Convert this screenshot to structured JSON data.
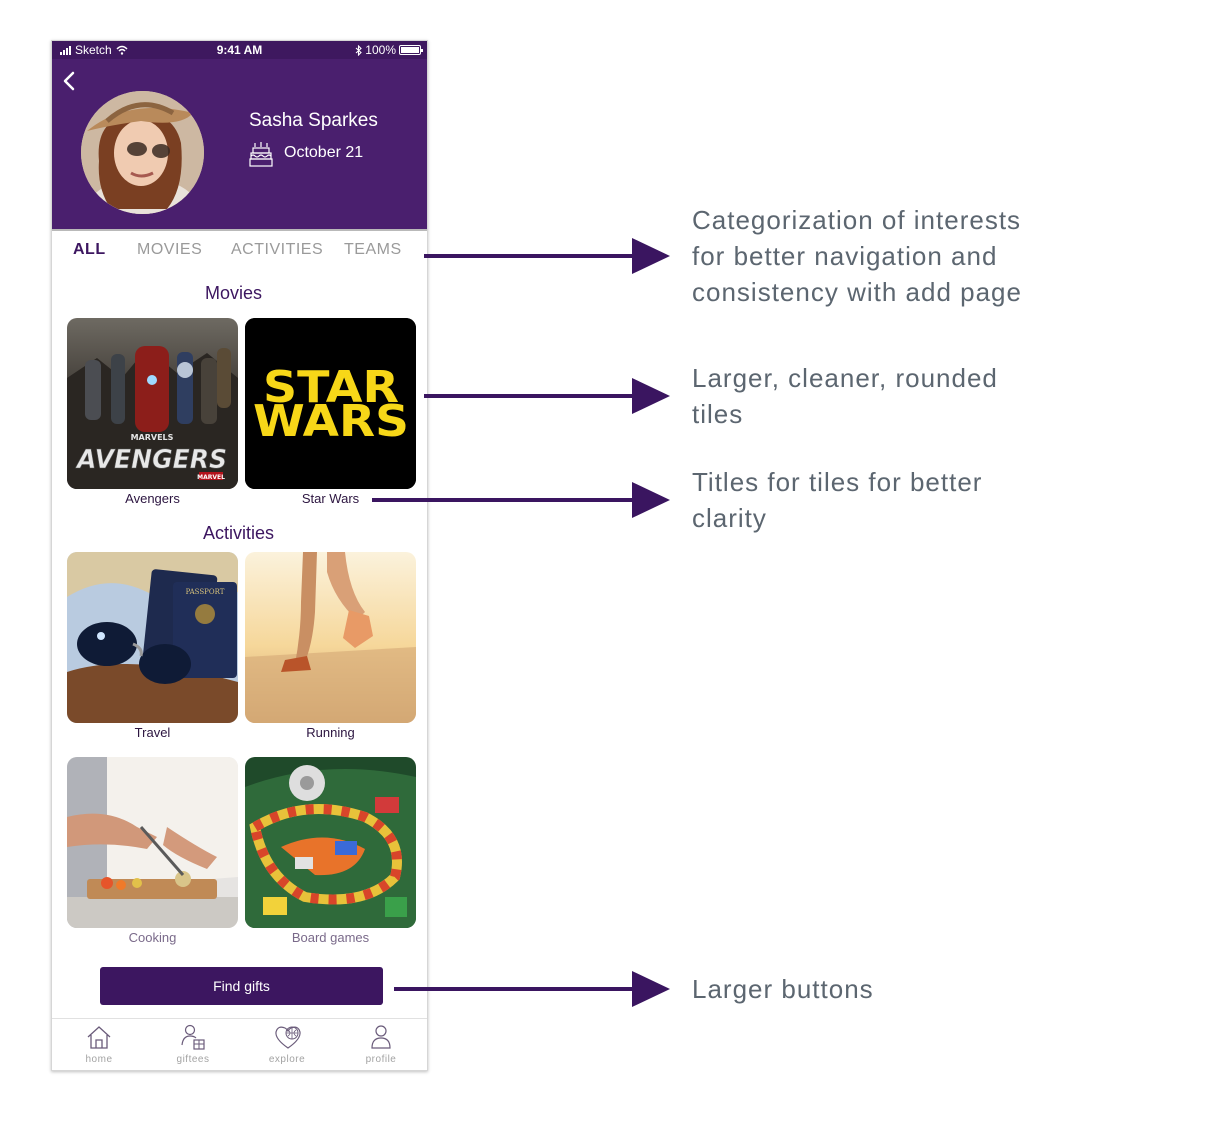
{
  "status_bar": {
    "carrier": "Sketch",
    "time": "9:41 AM",
    "battery": "100%",
    "battery_level": 1.0
  },
  "profile": {
    "name": "Sasha Sparkes",
    "birthday": "October 21"
  },
  "tabs": [
    {
      "label": "ALL",
      "active": true
    },
    {
      "label": "MOVIES",
      "active": false
    },
    {
      "label": "ACTIVITIES",
      "active": false
    },
    {
      "label": "TEAMS",
      "active": false
    }
  ],
  "movies": {
    "title": "Movies",
    "tiles": [
      {
        "label": "Avengers",
        "poster_text_top": "MARVELS",
        "poster_text": "AVENGERS",
        "poster_badge": "MARVEL"
      },
      {
        "label": "Star Wars",
        "logo_line1": "STAR",
        "logo_line2": "WARS"
      }
    ]
  },
  "activities": {
    "title": "Activities",
    "tiles": [
      {
        "label": "Travel",
        "passport_text": "PASSPORT"
      },
      {
        "label": "Running"
      },
      {
        "label": "Cooking"
      },
      {
        "label": "Board games"
      }
    ]
  },
  "find_gifts_label": "Find gifts",
  "tabbar": [
    {
      "label": "home",
      "icon": "home-icon"
    },
    {
      "label": "giftees",
      "icon": "giftees-icon"
    },
    {
      "label": "explore",
      "icon": "explore-icon"
    },
    {
      "label": "profile",
      "icon": "profile-icon"
    }
  ],
  "annotations": [
    {
      "lines": [
        "Categorization of interests",
        "for better navigation and",
        "consistency with add page"
      ]
    },
    {
      "lines": [
        "Larger, cleaner, rounded",
        "tiles"
      ]
    },
    {
      "lines": [
        "Titles for tiles for better",
        "clarity"
      ]
    },
    {
      "lines": [
        "Larger buttons"
      ]
    }
  ],
  "colors": {
    "brand_purple": "#4a1f6e",
    "dark_purple": "#3c1660",
    "annotation_text": "#5c6670",
    "arrow": "#3a1560"
  }
}
